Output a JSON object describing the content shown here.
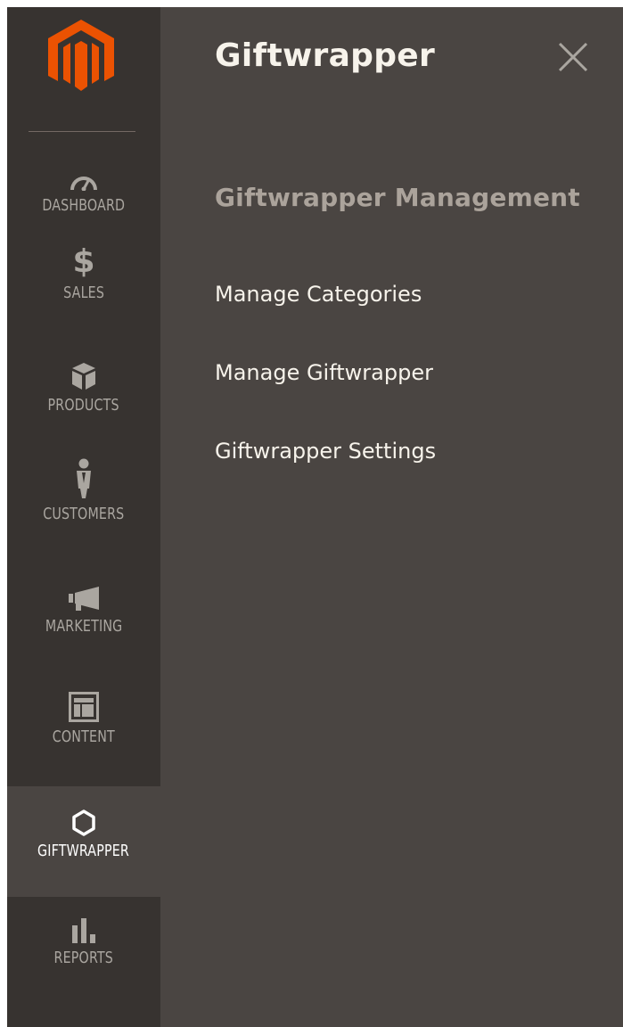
{
  "colors": {
    "sidebar_bg": "#373330",
    "panel_bg": "#4a4542",
    "logo_orange": "#eb5202",
    "text_light": "#f7f3eb",
    "text_muted": "#aaa6a0",
    "section_title": "#aba39b"
  },
  "sidebar": {
    "logo_icon": "magento-logo-icon",
    "items": [
      {
        "label": "DASHBOARD",
        "icon": "dashboard-icon"
      },
      {
        "label": "SALES",
        "icon": "dollar-icon"
      },
      {
        "label": "PRODUCTS",
        "icon": "box-icon"
      },
      {
        "label": "CUSTOMERS",
        "icon": "person-icon"
      },
      {
        "label": "MARKETING",
        "icon": "megaphone-icon"
      },
      {
        "label": "CONTENT",
        "icon": "layout-icon"
      },
      {
        "label": "GIFTWRAPPER",
        "icon": "hexagon-icon",
        "active": true
      },
      {
        "label": "REPORTS",
        "icon": "bar-chart-icon"
      }
    ]
  },
  "panel": {
    "title": "Giftwrapper",
    "close_icon": "close-icon",
    "section_title": "Giftwrapper Management",
    "links": [
      "Manage Categories",
      "Manage Giftwrapper",
      "Giftwrapper Settings"
    ]
  }
}
